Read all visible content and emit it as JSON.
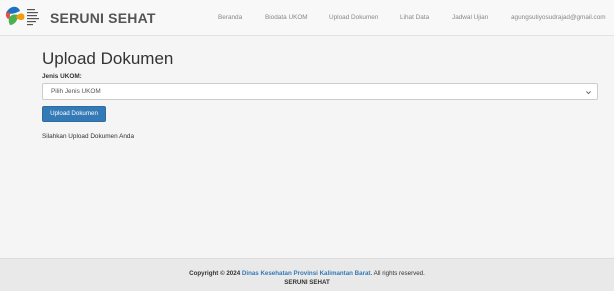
{
  "header": {
    "brand": "SERUNI SEHAT",
    "nav": {
      "beranda": "Beranda",
      "biodata": "Biodata UKOM",
      "upload": "Upload Dokumen",
      "lihat": "Lihat Data",
      "jadwal": "Jadwal Ujian",
      "email": "agungsutiyosudrajad@gmail.com"
    }
  },
  "main": {
    "title": "Upload Dokumen",
    "field_label": "Jenis UKOM:",
    "select_value": "Pilih Jenis UKOM",
    "submit_label": "Upload Dokumen",
    "hint": "Silahkan Upload Dokumen Anda"
  },
  "footer": {
    "copyright_prefix": "Copyright © 2024",
    "org_link": "Dinas Kesehatan Provinsi Kalimantan Barat.",
    "rights": "All rights reserved.",
    "brand": "SERUNI SEHAT"
  },
  "icons": {
    "logo": "seruni-sehat-logo-icon",
    "chevron": "chevron-down-icon"
  },
  "colors": {
    "primary": "#337ab7",
    "logo_green": "#4caf50",
    "logo_blue": "#1e73be",
    "logo_orange": "#f39c12"
  }
}
